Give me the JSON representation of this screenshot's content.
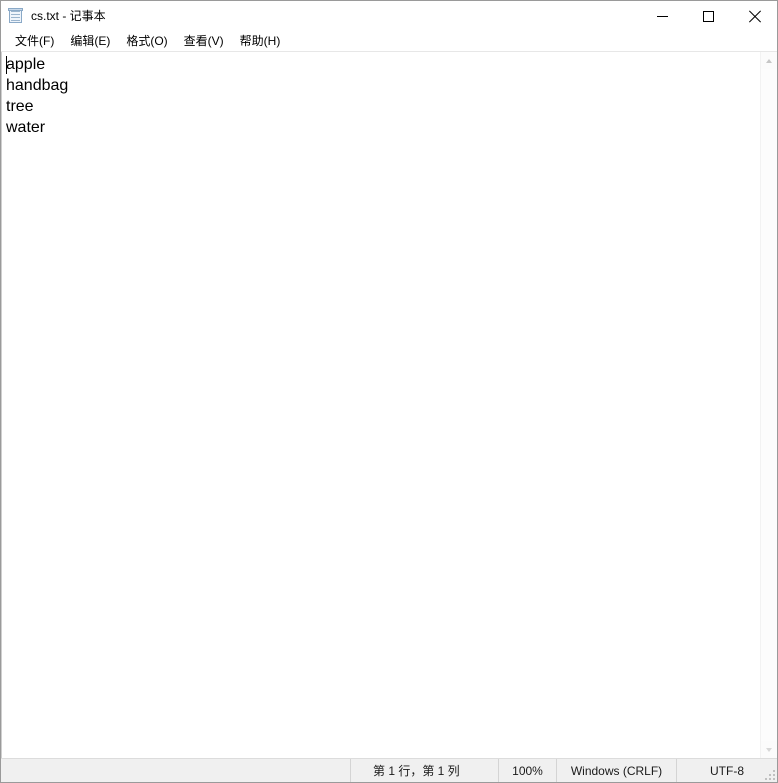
{
  "window": {
    "title": "cs.txt - 记事本",
    "icon": "notepad-icon",
    "controls": {
      "minimize_label": "最小化",
      "maximize_label": "最大化",
      "close_label": "关闭"
    }
  },
  "menubar": {
    "items": [
      {
        "label": "文件(F)"
      },
      {
        "label": "编辑(E)"
      },
      {
        "label": "格式(O)"
      },
      {
        "label": "查看(V)"
      },
      {
        "label": "帮助(H)"
      }
    ]
  },
  "editor": {
    "lines": [
      "apple",
      "handbag",
      "tree",
      "water"
    ],
    "caret_line": 1,
    "caret_column": 1
  },
  "scrollbar": {
    "up_arrow": "chevron-up-icon",
    "down_arrow": "chevron-down-icon"
  },
  "statusbar": {
    "position": "第 1 行，第 1 列",
    "zoom": "100%",
    "line_ending": "Windows (CRLF)",
    "encoding": "UTF-8"
  },
  "colors": {
    "window_bg": "#ffffff",
    "statusbar_bg": "#f0f0f0",
    "text": "#000000",
    "border": "#9a9a9a",
    "scrollbar_track": "#fbfbfb"
  }
}
